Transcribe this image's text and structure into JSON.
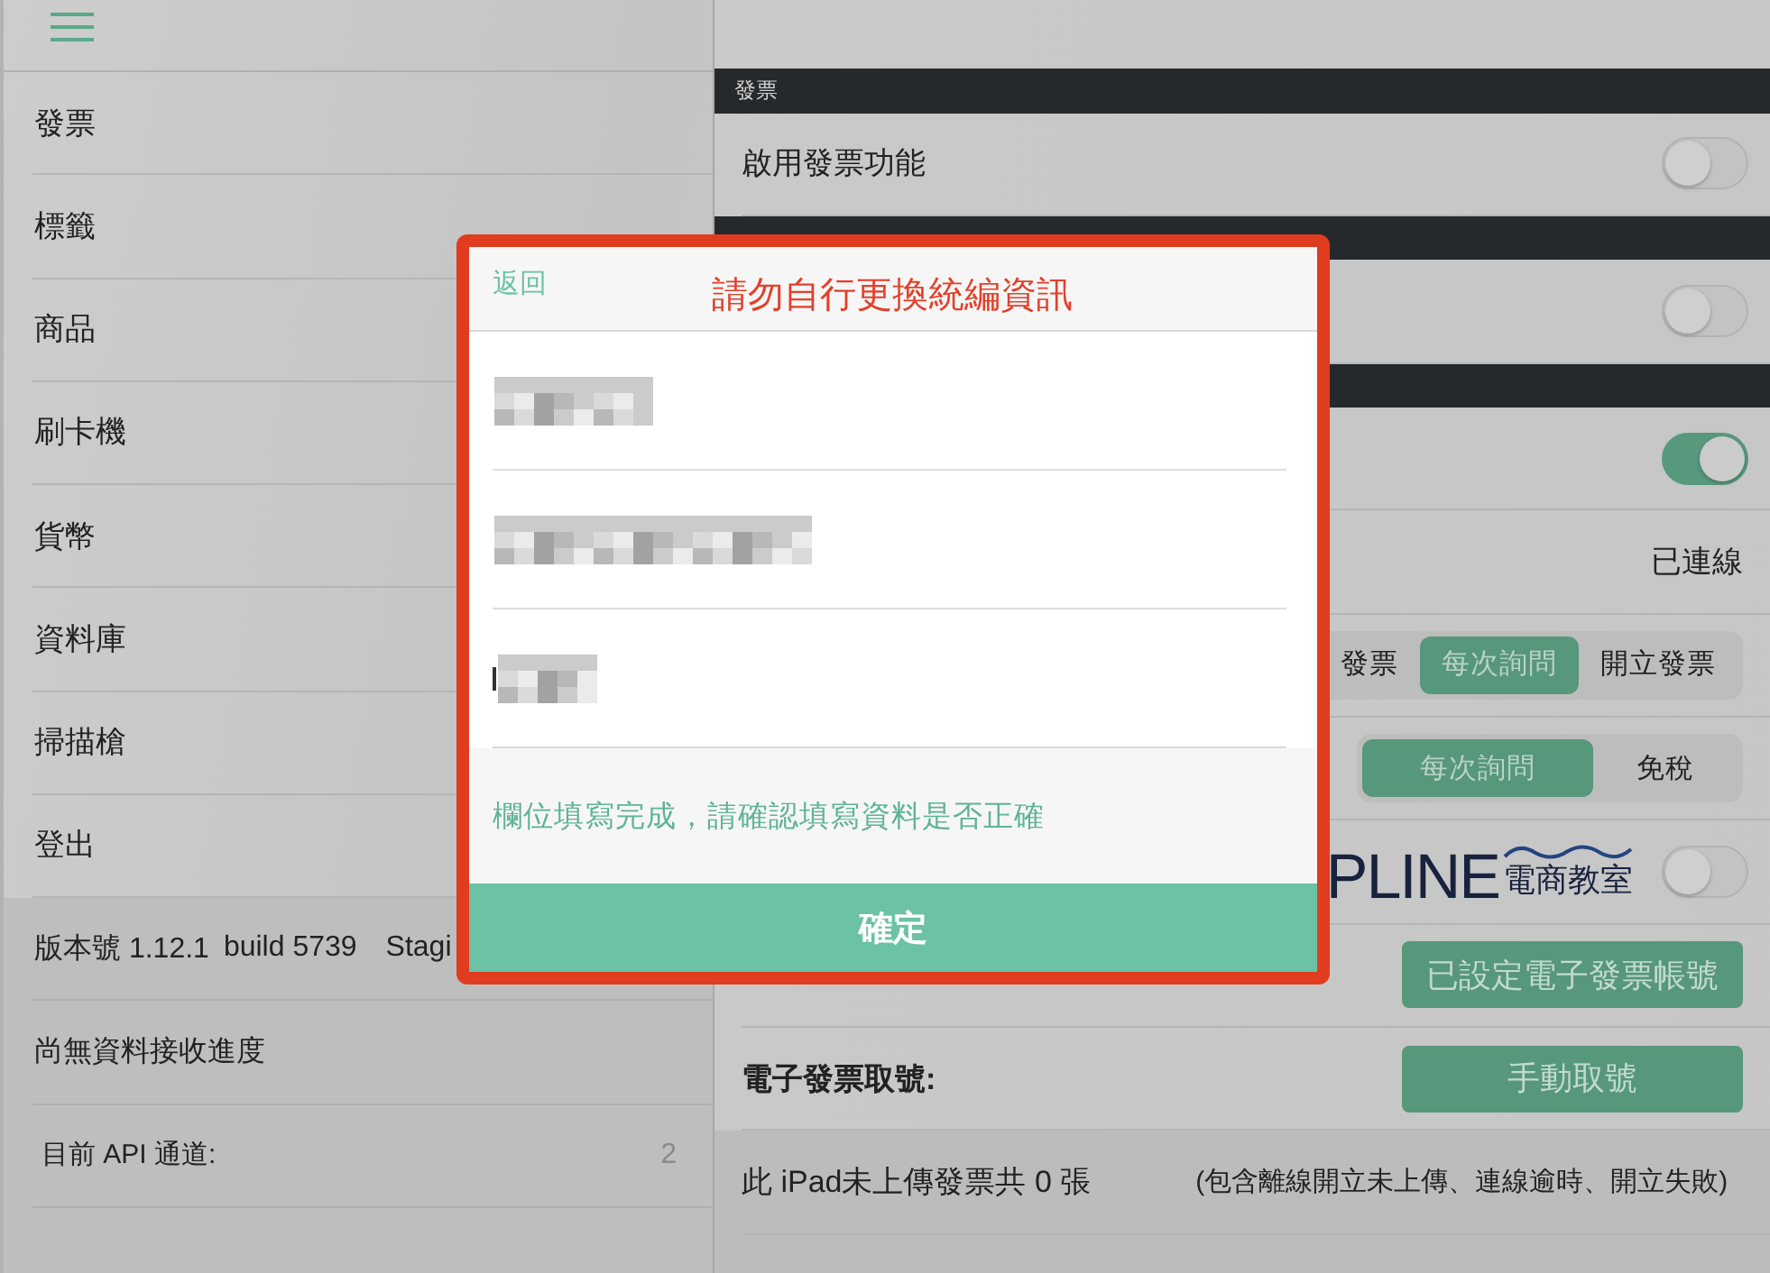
{
  "sidebar": {
    "menu_items": [
      {
        "label": "發票"
      },
      {
        "label": "標籤"
      },
      {
        "label": "商品"
      },
      {
        "label": "刷卡機"
      },
      {
        "label": "貨幣"
      },
      {
        "label": "資料庫"
      },
      {
        "label": "掃描槍"
      },
      {
        "label": "登出"
      }
    ],
    "info_rows": [
      {
        "kind": "version",
        "version": "版本號 1.12.1",
        "build": "build 5739",
        "environment": "Stagi"
      },
      {
        "kind": "text",
        "label": "尚無資料接收進度"
      },
      {
        "kind": "value",
        "label": "目前 API 通道:",
        "value": "2"
      }
    ]
  },
  "settings": {
    "rows": [
      {
        "kind": "header",
        "label": "發票"
      },
      {
        "kind": "toggle",
        "label": "啟用發票功能",
        "on": false
      },
      {
        "kind": "header"
      },
      {
        "kind": "toggle",
        "on": false
      },
      {
        "kind": "header"
      },
      {
        "kind": "toggle",
        "on": true
      },
      {
        "kind": "status",
        "value": "已連線"
      },
      {
        "kind": "segmented",
        "options": [
          {
            "label": "發票",
            "selected": false
          },
          {
            "label": "每次詢問",
            "selected": true
          },
          {
            "label": "開立發票",
            "selected": false
          }
        ]
      },
      {
        "kind": "segmented",
        "options": [
          {
            "label": "每次詢問",
            "selected": true
          },
          {
            "label": "免稅",
            "selected": false
          }
        ]
      },
      {
        "kind": "logo_toggle",
        "logo": "PLINE",
        "logo_subtitle": "電商教室",
        "on": false
      },
      {
        "kind": "button",
        "button": "已設定電子發票帳號"
      },
      {
        "kind": "button",
        "label": "電子發票取號:",
        "button": "手動取號"
      },
      {
        "kind": "note",
        "label": "此 iPad未上傳發票共 0 張",
        "detail": "(包含離線開立未上傳、連線逾時、開立失敗)"
      }
    ]
  },
  "dialog": {
    "back": "返回",
    "title": "請勿自行更換統編資訊",
    "fields": [
      {
        "redacted": true,
        "focused": false
      },
      {
        "redacted": true,
        "focused": false
      },
      {
        "redacted": true,
        "focused": true
      }
    ],
    "message": "欄位填寫完成，請確認填寫資料是否正確",
    "confirm": "確定"
  }
}
